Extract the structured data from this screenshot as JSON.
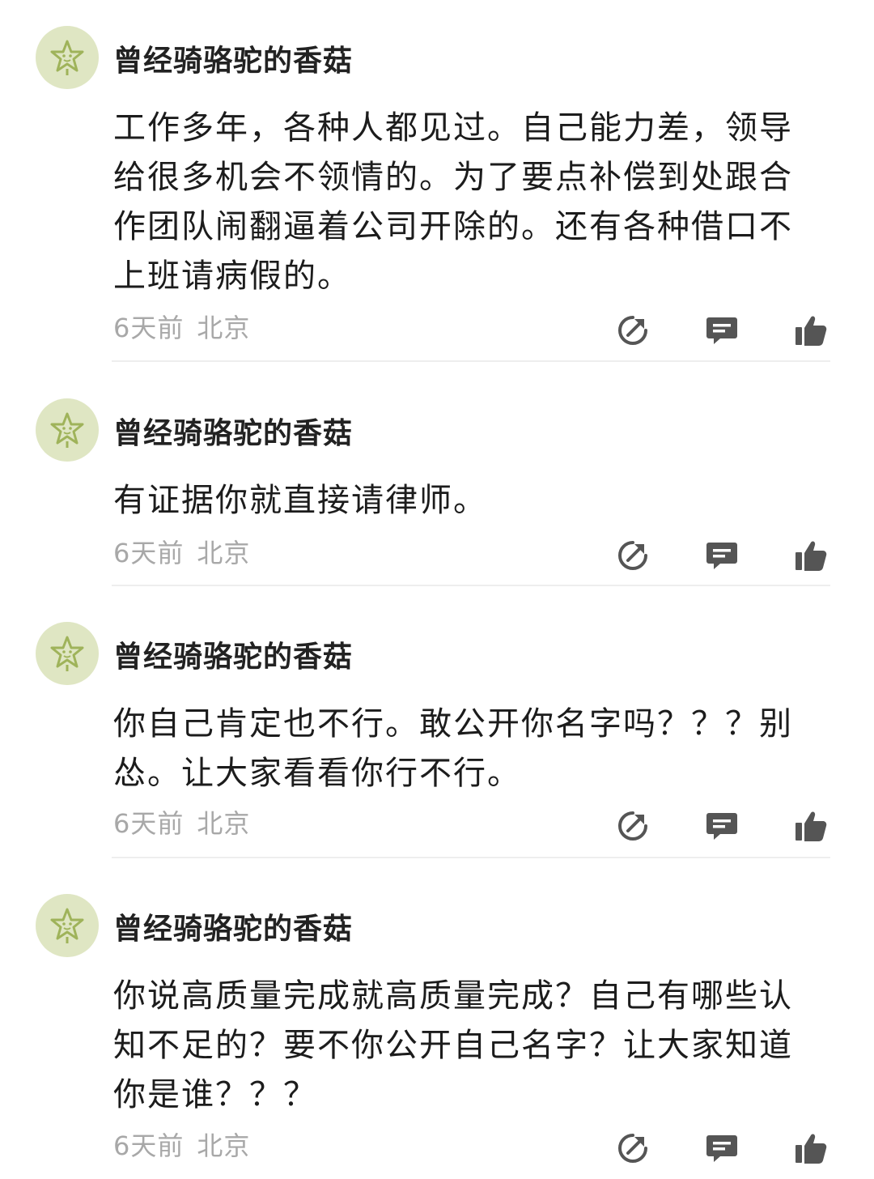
{
  "comments": [
    {
      "username": "曾经骑骆驼的香菇",
      "text": "工作多年，各种人都见过。自己能力差，领导给很多机会不领情的。为了要点补偿到处跟合作团队闹翻逼着公司开除的。还有各种借口不上班请病假的。",
      "time": "6天前",
      "location": "北京"
    },
    {
      "username": "曾经骑骆驼的香菇",
      "text": "有证据你就直接请律师。",
      "time": "6天前",
      "location": "北京"
    },
    {
      "username": "曾经骑骆驼的香菇",
      "text": "你自己肯定也不行。敢公开你名字吗？？？别怂。让大家看看你行不行。",
      "time": "6天前",
      "location": "北京"
    },
    {
      "username": "曾经骑骆驼的香菇",
      "text": "你说高质量完成就高质量完成？自己有哪些认知不足的？要不你公开自己名字？让大家知道你是谁？？？",
      "time": "6天前",
      "location": "北京"
    }
  ],
  "icons": {
    "avatar": "star-face-icon",
    "share": "share-icon",
    "reply": "reply-icon",
    "like": "thumbs-up-icon"
  },
  "colors": {
    "avatar_bg": "#dfe6c3",
    "avatar_star": "#9fb35a",
    "meta_text": "#a8a8a8",
    "action_icon": "#555555"
  }
}
